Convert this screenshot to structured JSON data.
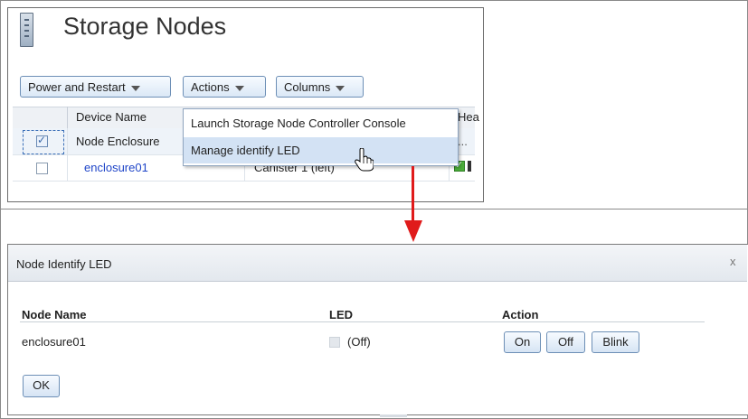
{
  "top_panel": {
    "title": "Storage Nodes",
    "toolbar": {
      "power_restart": "Power and Restart",
      "actions": "Actions",
      "columns": "Columns"
    },
    "grid": {
      "col_device_name": "Device Name",
      "col_hea_partial": "Hea",
      "row1_name": "Node Enclosure",
      "row1_tail": "...",
      "row2_name": "enclosure01",
      "row2_canister": "Canister 1 (left)"
    },
    "menu": {
      "items": [
        "Launch Storage Node Controller Console",
        "Manage identify LED"
      ],
      "hovered_index": 1
    }
  },
  "dialog": {
    "title": "Node Identify LED",
    "close": "x",
    "headers": [
      "Node Name",
      "LED",
      "Action"
    ],
    "row": {
      "node_name": "enclosure01",
      "led_state": "(Off)"
    },
    "buttons": {
      "on": "On",
      "off": "Off",
      "blink": "Blink"
    },
    "ok": "OK"
  },
  "colors": {
    "arrow": "#e01b1b",
    "link": "#1f45c8",
    "menu_hover": "#d3e2f4"
  },
  "icons": [
    "storage-node-icon",
    "caret-down-icon",
    "hand-cursor-icon",
    "green-check-icon",
    "close-icon",
    "led-off-icon"
  ]
}
